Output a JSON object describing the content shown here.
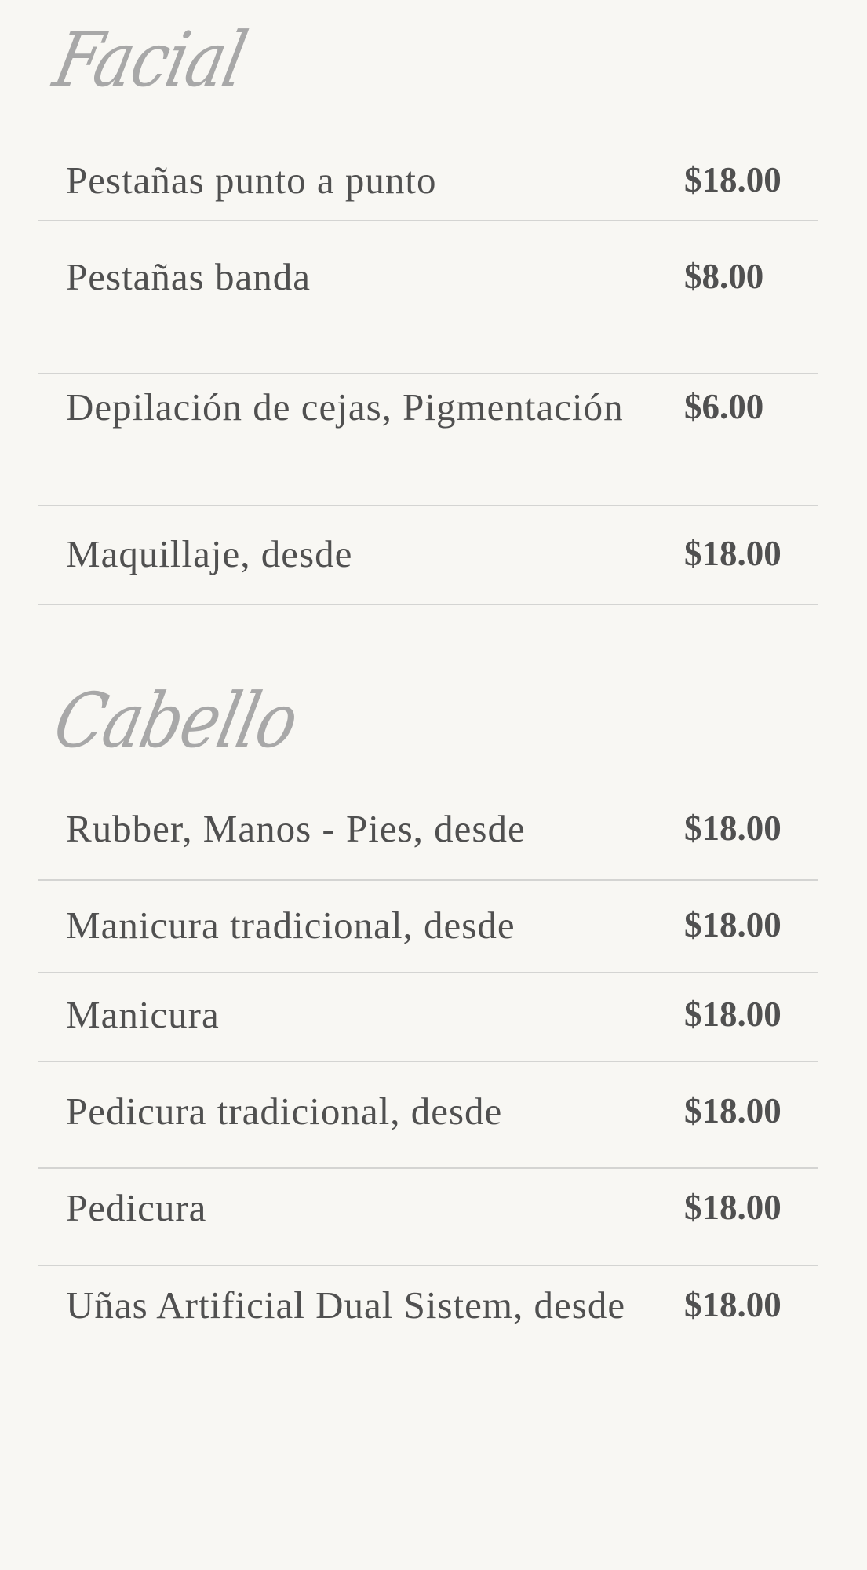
{
  "background": "#f8f7f3",
  "text_color": "#505050",
  "title_color": "#a8a8a8",
  "divider_color": "#d4d4d2",
  "sections": [
    {
      "title": "Facial",
      "items": [
        {
          "name": "Pestañas punto a punto",
          "price": "$18.00"
        },
        {
          "name": "Pestañas banda",
          "price": "$8.00"
        },
        {
          "name": "Depilación de cejas, Pigmentación",
          "price": "$6.00"
        },
        {
          "name": "Maquillaje, desde",
          "price": "$18.00"
        }
      ]
    },
    {
      "title": "Cabello",
      "items": [
        {
          "name": "Rubber, Manos - Pies, desde",
          "price": "$18.00"
        },
        {
          "name": "Manicura tradicional, desde",
          "price": "$18.00"
        },
        {
          "name": "Manicura",
          "price": "$18.00"
        },
        {
          "name": "Pedicura tradicional, desde",
          "price": "$18.00"
        },
        {
          "name": "Pedicura",
          "price": "$18.00"
        },
        {
          "name": "Uñas Artificial Dual Sistem, desde",
          "price": "$18.00"
        }
      ]
    }
  ]
}
